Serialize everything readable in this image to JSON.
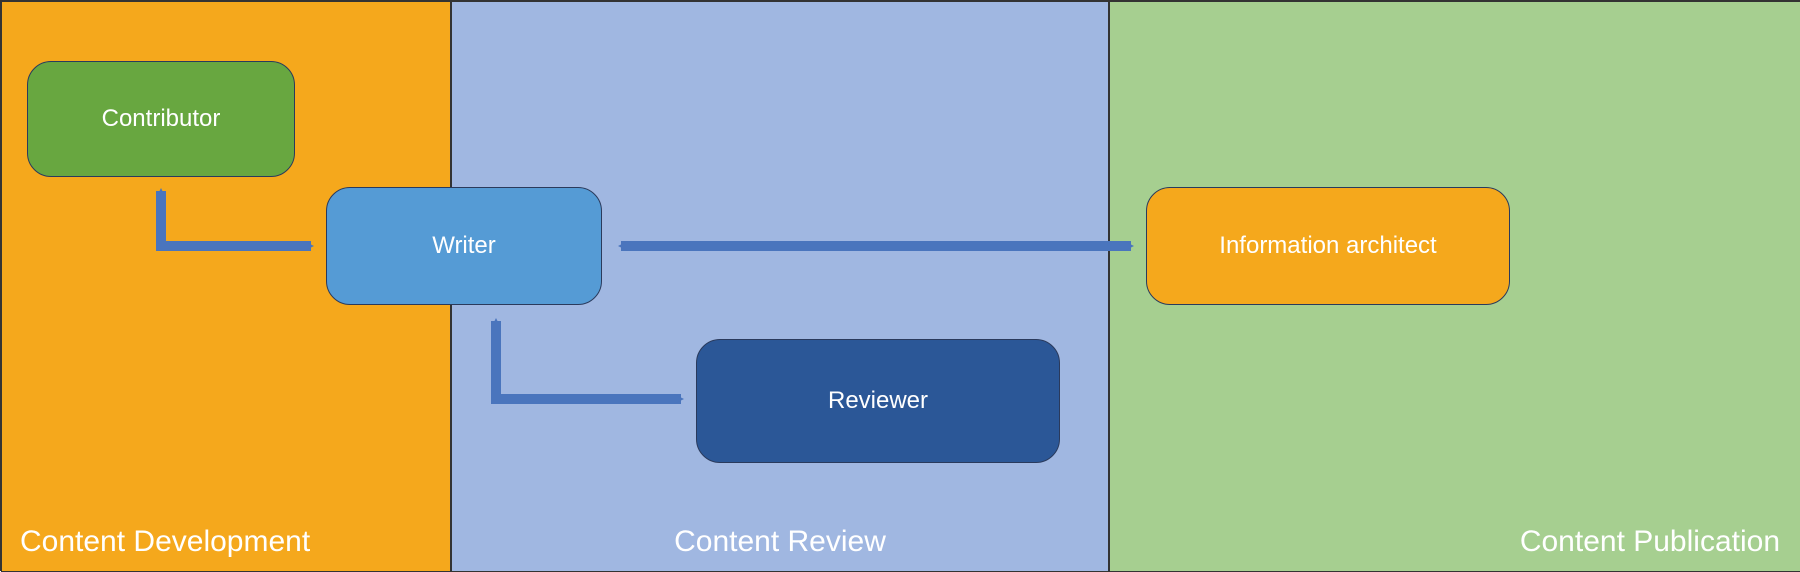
{
  "lanes": {
    "development": {
      "label": "Content Development"
    },
    "review": {
      "label": "Content Review"
    },
    "publication": {
      "label": "Content Publication"
    }
  },
  "boxes": {
    "contributor": {
      "label": "Contributor"
    },
    "writer": {
      "label": "Writer"
    },
    "reviewer": {
      "label": "Reviewer"
    },
    "architect": {
      "label": "Information architect"
    }
  },
  "colors": {
    "lane_dev": "#f5a81c",
    "lane_rev": "#a0b7e1",
    "lane_pub": "#a6cf90",
    "contributor": "#68a740",
    "writer": "#559bd5",
    "reviewer": "#2b5797",
    "architect": "#f5a81c",
    "arrow": "#4a75bd"
  }
}
